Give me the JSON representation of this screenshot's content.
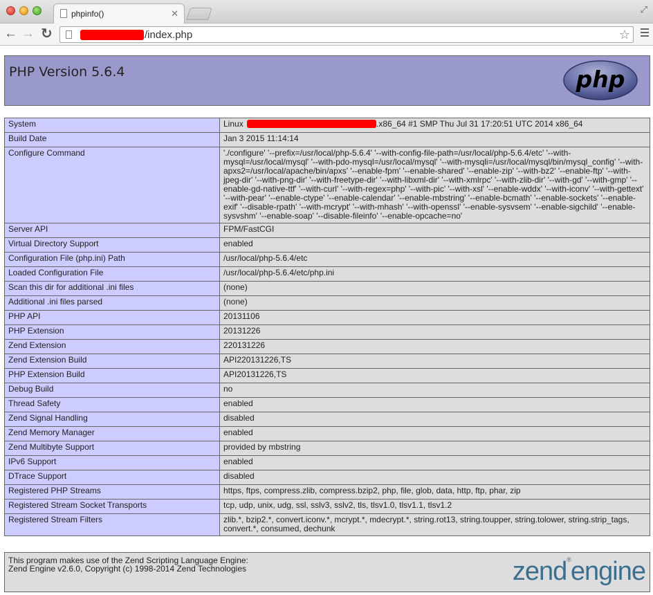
{
  "browser": {
    "tab_title": "phpinfo()",
    "tab_close": "✕",
    "url_suffix": "/index.php"
  },
  "page": {
    "php_version": "PHP Version 5.6.4",
    "php_logo_text": "php",
    "system_linux": "Linux ",
    "system_suffix": ".x86_64 #1 SMP Thu Jul 31 17:20:51 UTC 2014 x86_64",
    "rows": [
      {
        "key": "Build Date",
        "value": "Jan 3 2015 11:14:14"
      },
      {
        "key": "Configure Command",
        "value": "'./configure' '--prefix=/usr/local/php-5.6.4' '--with-config-file-path=/usr/local/php-5.6.4/etc' '--with-mysql=/usr/local/mysql' '--with-pdo-mysql=/usr/local/mysql' '--with-mysqli=/usr/local/mysql/bin/mysql_config' '--with-apxs2=/usr/local/apache/bin/apxs' '--enable-fpm' '--enable-shared' '--enable-zip' '--with-bz2' '--enable-ftp' '--with-jpeg-dir' '--with-png-dir' '--with-freetype-dir' '--with-libxml-dir' '--with-xmlrpc' '--with-zlib-dir' '--with-gd' '--with-gmp' '--enable-gd-native-ttf' '--with-curl' '--with-regex=php' '--with-pic' '--with-xsl' '--enable-wddx' '--with-iconv' '--with-gettext' '--with-pear' '--enable-ctype' '--enable-calendar' '--enable-mbstring' '--enable-bcmath' '--enable-sockets' '--enable-exif' '--disable-rpath' '--with-mcrypt' '--with-mhash' '--with-openssl' '--enable-sysvsem' '--enable-sigchild' '--enable-sysvshm' '--enable-soap' '--disable-fileinfo' '--enable-opcache=no'"
      },
      {
        "key": "Server API",
        "value": "FPM/FastCGI"
      },
      {
        "key": "Virtual Directory Support",
        "value": "enabled"
      },
      {
        "key": "Configuration File (php.ini) Path",
        "value": "/usr/local/php-5.6.4/etc"
      },
      {
        "key": "Loaded Configuration File",
        "value": "/usr/local/php-5.6.4/etc/php.ini"
      },
      {
        "key": "Scan this dir for additional .ini files",
        "value": "(none)"
      },
      {
        "key": "Additional .ini files parsed",
        "value": "(none)"
      },
      {
        "key": "PHP API",
        "value": "20131106"
      },
      {
        "key": "PHP Extension",
        "value": "20131226"
      },
      {
        "key": "Zend Extension",
        "value": "220131226"
      },
      {
        "key": "Zend Extension Build",
        "value": "API220131226,TS"
      },
      {
        "key": "PHP Extension Build",
        "value": "API20131226,TS"
      },
      {
        "key": "Debug Build",
        "value": "no"
      },
      {
        "key": "Thread Safety",
        "value": "enabled"
      },
      {
        "key": "Zend Signal Handling",
        "value": "disabled"
      },
      {
        "key": "Zend Memory Manager",
        "value": "enabled"
      },
      {
        "key": "Zend Multibyte Support",
        "value": "provided by mbstring"
      },
      {
        "key": "IPv6 Support",
        "value": "enabled"
      },
      {
        "key": "DTrace Support",
        "value": "disabled"
      },
      {
        "key": "Registered PHP Streams",
        "value": "https, ftps, compress.zlib, compress.bzip2, php, file, glob, data, http, ftp, phar, zip"
      },
      {
        "key": "Registered Stream Socket Transports",
        "value": "tcp, udp, unix, udg, ssl, sslv3, sslv2, tls, tlsv1.0, tlsv1.1, tlsv1.2"
      },
      {
        "key": "Registered Stream Filters",
        "value": "zlib.*, bzip2.*, convert.iconv.*, mcrypt.*, mdecrypt.*, string.rot13, string.toupper, string.tolower, string.strip_tags, convert.*, consumed, dechunk"
      }
    ],
    "system_key": "System",
    "zend_line1": "This program makes use of the Zend Scripting Language Engine:",
    "zend_line2": "Zend Engine v2.6.0, Copyright (c) 1998-2014 Zend Technologies",
    "zend_logo_word1": "zend",
    "zend_logo_mark": "®",
    "zend_logo_word2": "engine"
  }
}
